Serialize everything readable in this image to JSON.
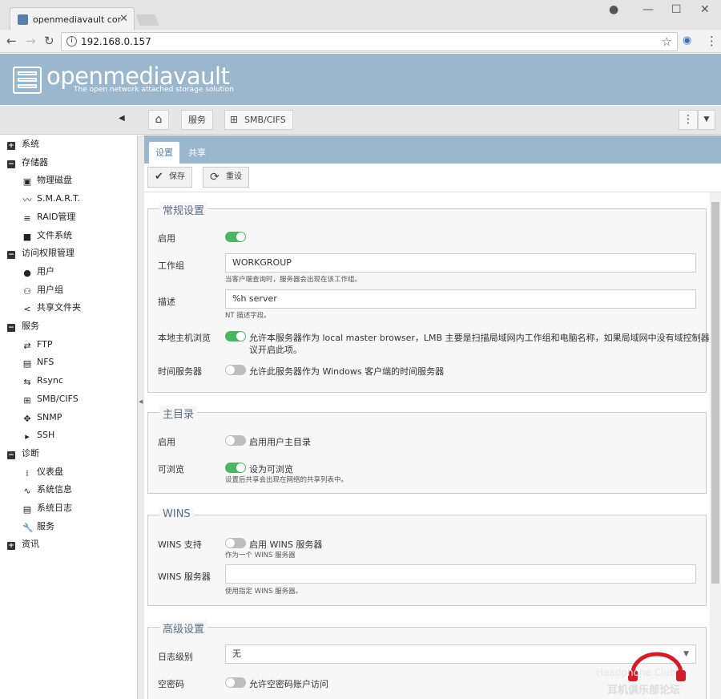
{
  "browser": {
    "tab_title": "openmediavault contr",
    "url": "192.168.0.157"
  },
  "app": {
    "brand": "openmediavault",
    "tagline": "The open network attached storage solution"
  },
  "breadcrumb": {
    "home_icon": "home-icon",
    "service": "服务",
    "current": "SMB/CIFS"
  },
  "sidebar": {
    "items": [
      {
        "label": "系统",
        "level": 0,
        "icon": "plus-icon"
      },
      {
        "label": "存储器",
        "level": 0,
        "icon": "minus-icon"
      },
      {
        "label": "物理磁盘",
        "level": 1,
        "icon": "disk-icon"
      },
      {
        "label": "S.M.A.R.T.",
        "level": 1,
        "icon": "pulse-icon"
      },
      {
        "label": "RAID管理",
        "level": 1,
        "icon": "database-icon"
      },
      {
        "label": "文件系统",
        "level": 1,
        "icon": "folder-icon"
      },
      {
        "label": "访问权限管理",
        "level": 0,
        "icon": "minus-icon"
      },
      {
        "label": "用户",
        "level": 1,
        "icon": "user-icon"
      },
      {
        "label": "用户组",
        "level": 1,
        "icon": "users-icon"
      },
      {
        "label": "共享文件夹",
        "level": 1,
        "icon": "share-icon"
      },
      {
        "label": "服务",
        "level": 0,
        "icon": "minus-icon"
      },
      {
        "label": "FTP",
        "level": 1,
        "icon": "ftp-icon"
      },
      {
        "label": "NFS",
        "level": 1,
        "icon": "nfs-icon"
      },
      {
        "label": "Rsync",
        "level": 1,
        "icon": "rsync-icon"
      },
      {
        "label": "SMB/CIFS",
        "level": 1,
        "icon": "windows-icon"
      },
      {
        "label": "SNMP",
        "level": 1,
        "icon": "snmp-icon"
      },
      {
        "label": "SSH",
        "level": 1,
        "icon": "terminal-icon"
      },
      {
        "label": "诊断",
        "level": 0,
        "icon": "minus-icon"
      },
      {
        "label": "仪表盘",
        "level": 1,
        "icon": "dashboard-icon"
      },
      {
        "label": "系统信息",
        "level": 1,
        "icon": "chart-icon"
      },
      {
        "label": "系统日志",
        "level": 1,
        "icon": "log-icon"
      },
      {
        "label": "服务",
        "level": 1,
        "icon": "wrench-icon"
      },
      {
        "label": "资讯",
        "level": 0,
        "icon": "plus-icon"
      }
    ]
  },
  "tabs": [
    "设置",
    "共享"
  ],
  "actions": {
    "save": "保存",
    "reset": "重设"
  },
  "sections": {
    "general": {
      "title": "常规设置",
      "enable_label": "启用",
      "workgroup_label": "工作组",
      "workgroup_value": "WORKGROUP",
      "workgroup_hint": "当客户端查询时，服务器会出现在该工作组。",
      "desc_label": "描述",
      "desc_value": "%h server",
      "desc_hint": "NT 描述字段。",
      "browse_label": "本地主机浏览",
      "browse_text_1": "允许本服务器作为 local master browser，LMB 主要是扫描局域网内工作组和电脑名称，如果局域网中没有域控制器建",
      "browse_text_2": "议开启此项。",
      "time_label": "时间服务器",
      "time_text": "允许此服务器作为 Windows 客户端的时间服务器"
    },
    "homes": {
      "title": "主目录",
      "enable_label": "启用",
      "enable_text": "启用用户主目录",
      "browse_label": "可浏览",
      "browse_text": "设为可浏览",
      "browse_hint": "设置后共享会出现在网络的共享列表中。"
    },
    "wins": {
      "title": "WINS",
      "support_label": "WINS 支持",
      "support_text": "启用 WINS 服务器",
      "support_hint": "作为一个 WINS 服务器",
      "server_label": "WINS 服务器",
      "server_value": "",
      "server_hint": "使用指定 WINS 服务器。"
    },
    "advanced": {
      "title": "高级设置",
      "log_label": "日志级别",
      "log_value": "无",
      "null_label": "空密码",
      "null_text": "允许空密码账户访问"
    }
  },
  "watermark": {
    "line1": "Headphone Club",
    "line2": "耳机俱乐部论坛"
  },
  "colors": {
    "header": "#9bb7ce",
    "toggle_on": "#4cb665",
    "toggle_off": "#bdbdbd"
  }
}
